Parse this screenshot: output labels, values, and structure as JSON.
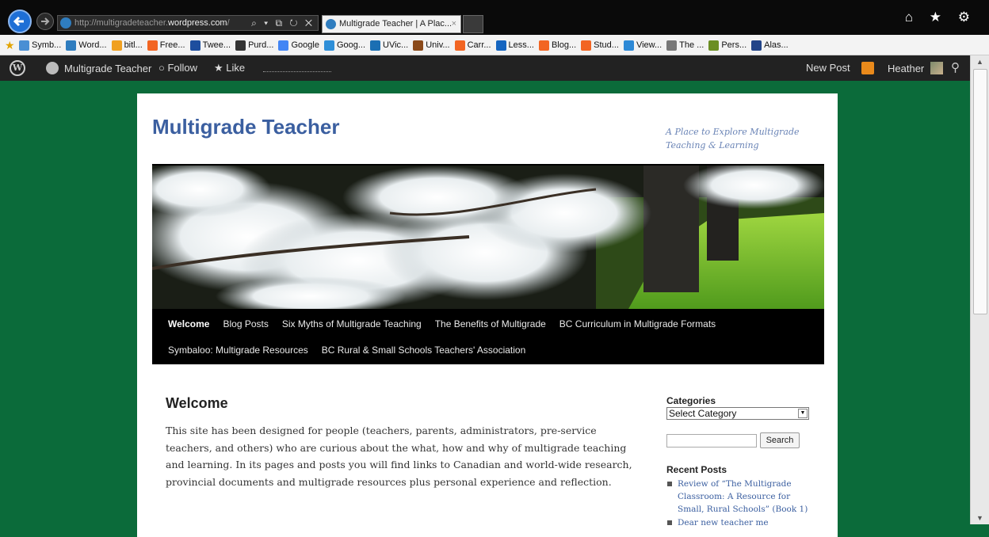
{
  "browser": {
    "url_prefix": "http://multigradeteacher.",
    "url_domain": "wordpress.com",
    "url_suffix": "/",
    "address_controls": "⌕ ▾ ⧉ ↻ ✕",
    "tab_title": "Multigrade Teacher | A Plac...",
    "tab_close": "×",
    "system_icons": "⌂ ★ ⚙"
  },
  "favorites": [
    {
      "label": "Symb...",
      "color": "#4a8fd4"
    },
    {
      "label": "Word...",
      "color": "#2f7dbf"
    },
    {
      "label": "bitl...",
      "color": "#f0a020"
    },
    {
      "label": "Free...",
      "color": "#f26522"
    },
    {
      "label": "Twee...",
      "color": "#1d4e9e"
    },
    {
      "label": "Purd...",
      "color": "#333333"
    },
    {
      "label": "Google",
      "color": "#4285f4"
    },
    {
      "label": "Goog...",
      "color": "#2f8fd8"
    },
    {
      "label": "UVic...",
      "color": "#1b6fb3"
    },
    {
      "label": "Univ...",
      "color": "#8b4a1a"
    },
    {
      "label": "Carr...",
      "color": "#f26522"
    },
    {
      "label": "Less...",
      "color": "#1565c0"
    },
    {
      "label": "Blog...",
      "color": "#f26522"
    },
    {
      "label": "Stud...",
      "color": "#f26522"
    },
    {
      "label": "View...",
      "color": "#2d89d6"
    },
    {
      "label": "The ...",
      "color": "#777777"
    },
    {
      "label": "Pers...",
      "color": "#6b8e23"
    },
    {
      "label": "Alas...",
      "color": "#224488"
    }
  ],
  "adminbar": {
    "wp_logo": "W",
    "site_name": "Multigrade Teacher",
    "follow": "○ Follow",
    "like": "★ Like",
    "new_post": "New Post",
    "user": "Heather",
    "search_icon": "⚲"
  },
  "site": {
    "title": "Multigrade Teacher",
    "tagline": "A Place to Explore Multigrade Teaching & Learning"
  },
  "nav": {
    "row1": [
      "Welcome",
      "Blog Posts",
      "Six Myths of Multigrade Teaching",
      "The Benefits of Multigrade",
      "BC Curriculum in Multigrade Formats"
    ],
    "row2": [
      "Symbaloo: Multigrade Resources",
      "BC Rural & Small Schools Teachers' Association"
    ]
  },
  "post": {
    "title": "Welcome",
    "body": "This site has been designed for people (teachers, parents, administrators, pre-service teachers, and others) who are curious about the what, how and why of multigrade teaching and learning.  In its pages and posts you will find links to Canadian and world-wide research, provincial documents and multigrade resources plus personal experience and reflection."
  },
  "sidebar": {
    "categories_heading": "Categories",
    "category_select": "Select Category",
    "search_button": "Search",
    "recent_heading": "Recent Posts",
    "recent_posts": [
      "Review of “The Multigrade Classroom: A Resource for Small, Rural Schools” (Book 1)",
      "Dear new teacher me"
    ]
  }
}
